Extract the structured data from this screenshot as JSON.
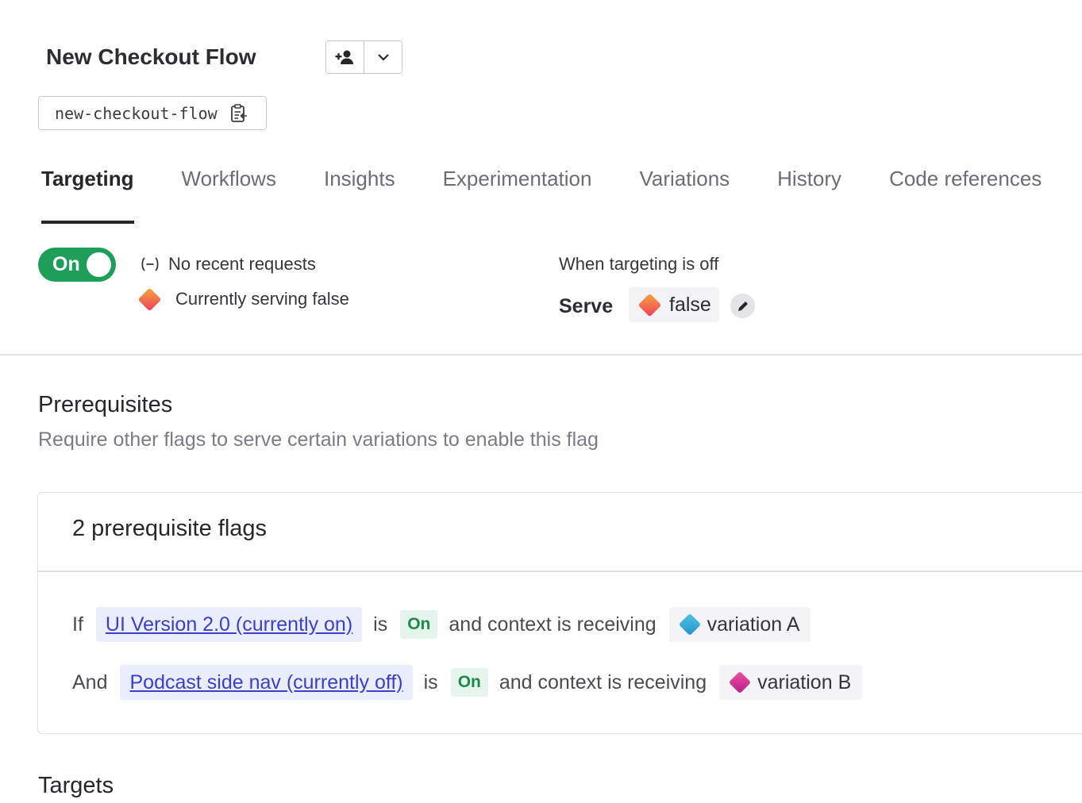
{
  "header": {
    "title": "New Checkout Flow",
    "flag_key": "new-checkout-flow"
  },
  "tabs": [
    {
      "label": "Targeting",
      "active": true
    },
    {
      "label": "Workflows"
    },
    {
      "label": "Insights"
    },
    {
      "label": "Experimentation"
    },
    {
      "label": "Variations"
    },
    {
      "label": "History"
    },
    {
      "label": "Code references"
    }
  ],
  "targeting": {
    "toggle_label": "On",
    "requests_status": "No recent requests",
    "serving_status": "Currently serving false",
    "off_heading": "When targeting is off",
    "serve_label": "Serve",
    "serve_value": "false"
  },
  "prerequisites": {
    "title": "Prerequisites",
    "subtitle": "Require other flags to serve certain variations to enable this flag",
    "card_title": "2 prerequisite flags",
    "rules": [
      {
        "prefix": "If",
        "flag": "UI Version 2.0 (currently on)",
        "is": "is",
        "state": "On",
        "context": "and context is receiving",
        "variation": "variation A"
      },
      {
        "prefix": "And",
        "flag": "Podcast side nav (currently off)",
        "is": "is",
        "state": "On",
        "context": "and context is receiving",
        "variation": "variation B"
      }
    ]
  },
  "targets": {
    "title": "Targets"
  },
  "colors": {
    "toggle_on": "#1f9e5a",
    "link": "#3b40c9",
    "link_bg": "#eaeefc",
    "on_badge_text": "#1b8a4e"
  },
  "icons": {
    "assign": "add-person-icon",
    "menu": "chevron-down-icon",
    "copy": "copy-key-icon",
    "requests": "no-requests-icon",
    "edit": "pencil-icon"
  }
}
